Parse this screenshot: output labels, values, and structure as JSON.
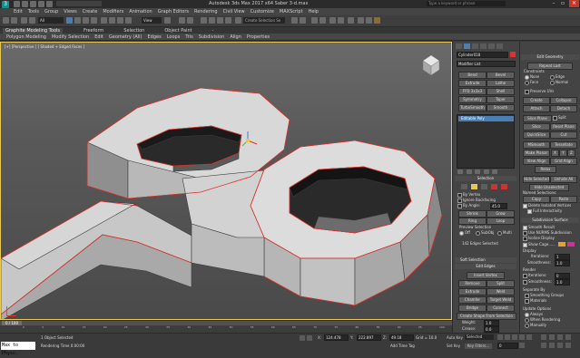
{
  "window": {
    "title": "Autodesk 3ds Max 2017 x64    Saber 3-d.max",
    "search_placeholder": "Type a keyword or phrase"
  },
  "menu": [
    "Edit",
    "Tools",
    "Group",
    "Views",
    "Create",
    "Modifiers",
    "Animation",
    "Graph Editors",
    "Rendering",
    "Civil View",
    "Customize",
    "MAXScript",
    "Help"
  ],
  "toolbar": {
    "selection_filter": "All",
    "view_dropdown": "View",
    "selection_set": "Create Selection Se"
  },
  "ribbon": {
    "tabs": [
      "Graphite Modeling Tools",
      "Freeform",
      "Selection",
      "Object Paint",
      "-"
    ],
    "subtabs": [
      "Polygon Modeling",
      "Modify Selection",
      "Edit",
      "Geometry (All)",
      "Edges",
      "Loops",
      "Tris",
      "Subdivision",
      "Align",
      "Properties"
    ]
  },
  "viewport": {
    "label": "[+] [Perspective ] [ Shaded + Edged Faces ]"
  },
  "cmd_panel": {
    "object_name": "Cylinder018",
    "modifier_list": "Modifier List",
    "mod_buttons": [
      "Bend",
      "Bevel",
      "Extrude",
      "Lathe",
      "FFD 3x3x3",
      "Shell",
      "Symmetry",
      "Taper",
      "TurboSmooth",
      "Smooth"
    ],
    "stack_item": "Editable Poly",
    "selection_header": "Selection",
    "by_vertex": "By Vertex",
    "ignore_backfacing": "Ignore Backfacing",
    "by_angle": "By Angle:",
    "by_angle_value": "45.0",
    "shrink": "Shrink",
    "grow": "Grow",
    "ring": "Ring",
    "loop": "Loop",
    "preview_selection": "Preview Selection",
    "off": "Off",
    "subobj": "SubObj",
    "multi": "Multi",
    "edges_selected": "142 Edges Selected",
    "soft_selection": "Soft Selection",
    "edit_edges": "Edit Edges",
    "insert_vertex": "Insert Vertex",
    "remove": "Remove",
    "split": "Split",
    "extrude": "Extrude",
    "weld": "Weld",
    "chamfer": "Chamfer",
    "target_weld": "Target Weld",
    "bridge": "Bridge",
    "connect": "Connect",
    "create_shape": "Create Shape From Selection",
    "weight": "Weight:",
    "weight_value": "1.0",
    "crease": "Crease:",
    "crease_value": "0.0"
  },
  "edit_geometry": {
    "header": "Edit Geometry",
    "repeat_last": "Repeat Last",
    "constraints": "Constraints",
    "none": "None",
    "edge": "Edge",
    "face": "Face",
    "normal": "Normal",
    "preserve_uvs": "Preserve UVs",
    "create": "Create",
    "collapse": "Collapse",
    "attach": "Attach",
    "detach": "Detach",
    "slice_plane": "Slice Plane",
    "split": "Split",
    "slice": "Slice",
    "reset_plane": "Reset Plane",
    "quickslice": "QuickSlice",
    "cut": "Cut",
    "msmooth": "MSmooth",
    "tessellate": "Tessellate",
    "make_planar": "Make Planar",
    "x": "X",
    "y": "Y",
    "z": "Z",
    "view_align": "View Align",
    "grid_align": "Grid Align",
    "relax": "Relax",
    "hide_selected": "Hide Selected",
    "unhide_all": "Unhide All",
    "hide_unselected": "Hide Unselected",
    "named_selections": "Named Selections:",
    "copy": "Copy",
    "paste": "Paste",
    "delete_isolated": "Delete Isolated Vertices",
    "full_interactivity": "Full Interactivity",
    "subdivision_surface": "Subdivision Surface",
    "smooth_result": "Smooth Result",
    "use_nurms": "Use NURMS Subdivision",
    "isoline_display": "Isoline Display",
    "show_cage": "Show Cage......",
    "display": "Display",
    "iterations": "Iterations:",
    "iterations_value": "1",
    "smoothness": "Smoothness:",
    "smoothness_value": "1.0",
    "render": "Render",
    "r_iterations": "Iterations:",
    "r_iterations_value": "0",
    "r_smoothness": "Smoothness:",
    "r_smoothness_value": "1.0",
    "separate_by": "Separate By",
    "smoothing_groups": "Smoothing Groups",
    "materials": "Materials",
    "update_options": "Update Options",
    "always": "Always",
    "when_rendering": "When Rendering",
    "manually": "Manually"
  },
  "timeline": {
    "frame": "0 / 100",
    "ticks": [
      "0",
      "5",
      "10",
      "15",
      "20",
      "25",
      "30",
      "35",
      "40",
      "45",
      "50",
      "55",
      "60",
      "65",
      "70",
      "75",
      "80",
      "85",
      "90",
      "95",
      "100"
    ]
  },
  "status": {
    "maxscript": "Max to Physc.",
    "objects_selected": "1 Object Selected",
    "rendering_time": "Rendering Time  0:00:00",
    "x": "124.478",
    "y": "222.897",
    "z": "49.18",
    "grid": "Grid = 10.0",
    "add_time_tag": "Add Time Tag",
    "auto_key": "Auto Key",
    "set_key": "Set Key",
    "selected": "Selected",
    "key_filters": "Key Filters...",
    "frame_value": "0"
  }
}
